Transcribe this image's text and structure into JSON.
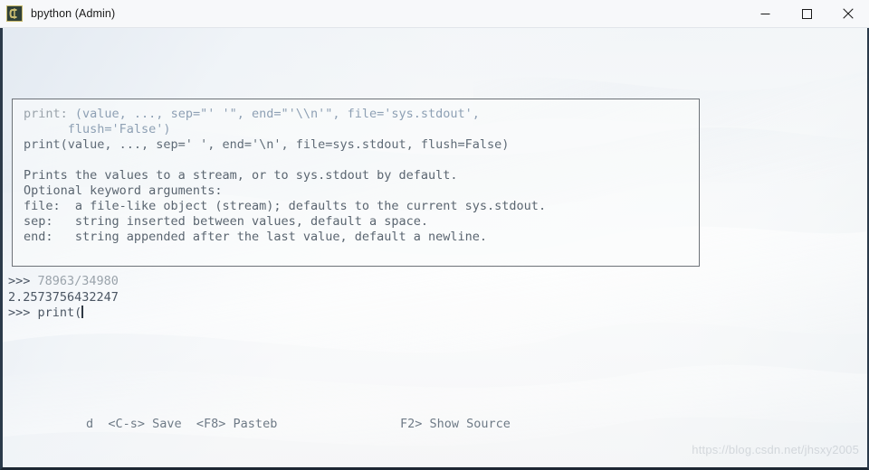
{
  "window": {
    "title": "bpython (Admin)",
    "icon": "bpython-logo-icon",
    "controls": {
      "minimize": "minimize-icon",
      "maximize": "maximize-icon",
      "close": "close-icon"
    }
  },
  "docbox": {
    "lines": [
      {
        "segments": [
          {
            "text": "print: ",
            "style": "name"
          },
          {
            "text": "(value, ..., sep=\"' '\", end=\"'\\\\n'\", file='sys.stdout',",
            "style": "sig"
          }
        ]
      },
      {
        "segments": [
          {
            "text": "      flush='False')",
            "style": "sig"
          }
        ]
      },
      {
        "segments": [
          {
            "text": "print(value, ..., sep=' ', end='\\n', file=sys.stdout, flush=False)",
            "style": "plain"
          }
        ]
      },
      {
        "blank": true,
        "segments": []
      },
      {
        "segments": [
          {
            "text": "Prints the values to a stream, or to sys.stdout by default.",
            "style": "doc"
          }
        ]
      },
      {
        "segments": [
          {
            "text": "Optional keyword arguments:",
            "style": "doc"
          }
        ]
      },
      {
        "segments": [
          {
            "text": "file:  a file-like object (stream); defaults to the current sys.stdout.",
            "style": "doc"
          }
        ]
      },
      {
        "segments": [
          {
            "text": "sep:   string inserted between values, default a space.",
            "style": "doc"
          }
        ]
      },
      {
        "segments": [
          {
            "text": "end:   string appended after the last value, default a newline.",
            "style": "doc"
          }
        ]
      }
    ]
  },
  "repl": {
    "input_line_1_prompt": ">>> ",
    "input_line_1_text": "78963/34980",
    "output_line_1": "2.2573756432247",
    "input_line_2_prompt": ">>> ",
    "input_line_2_text": "print("
  },
  "statusbar": {
    "left": "d  <C-s> Save  <F8> Pasteb",
    "right": "F2> Show Source"
  },
  "watermark": {
    "text": "https://blog.csdn.net/jhsxy2005"
  },
  "colors": {
    "titlebar_bg": "#f7f8fa",
    "terminal_border": "#2b3a4a",
    "docbox_border": "#6d7278",
    "prompt_color": "#4a5563",
    "echo_color": "#9aa3ab",
    "status_color": "#6e7a86"
  }
}
